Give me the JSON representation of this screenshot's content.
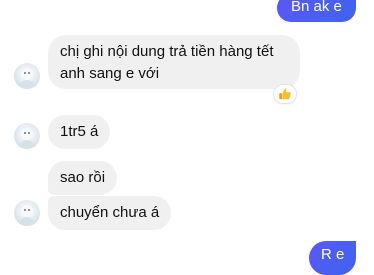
{
  "messages": {
    "out_1": {
      "text": "Bn ak e"
    },
    "in_1": {
      "line1": "chị ghi nội dung trả tiền hàng tết",
      "line2": "anh sang e với",
      "reaction_icon": "thumbs-up-icon"
    },
    "in_2": {
      "text": "1tr5 á"
    },
    "in_3": {
      "text": "sao rồi"
    },
    "in_4": {
      "text": "chuyển chưa á"
    },
    "out_2": {
      "text": "R e"
    }
  },
  "colors": {
    "outgoing_bubble": "#4f5ef1",
    "incoming_bubble": "#f0f0f0",
    "background": "#ffffff"
  }
}
